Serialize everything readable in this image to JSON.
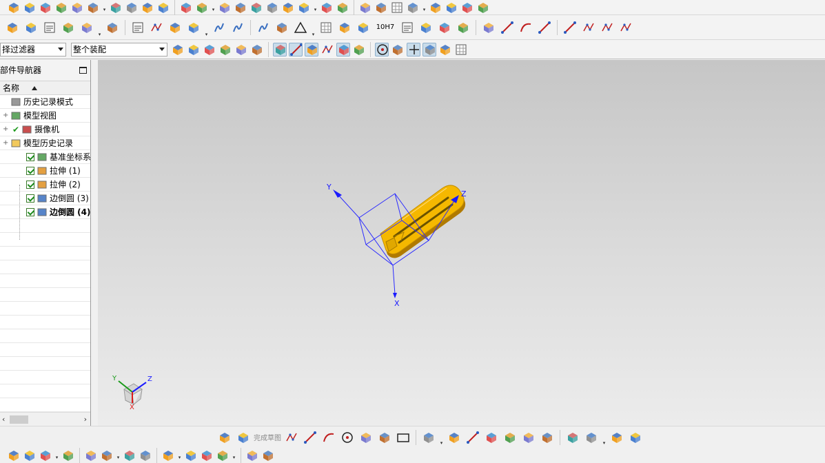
{
  "filters": {
    "selection_filter": "择过滤器",
    "scope": "整个装配"
  },
  "toolbar": {
    "row1_icons": [
      "block-icon",
      "cylinder-icon",
      "cube-icon",
      "extrude-icon",
      "chamfer-icon",
      "shell-icon",
      "boss-icon",
      "pattern-icon",
      "array-icon",
      "sweep-icon",
      "wedge-icon",
      "cube-blend-icon",
      "sheet-icon",
      "revolve-icon",
      "box-icon",
      "tube-icon",
      "cone-icon",
      "mirror-icon",
      "trim-icon",
      "surface-icon",
      "mesh-icon",
      "pyramid-icon",
      "grid-surface-icon",
      "patch-icon",
      "bridge-icon",
      "offset-icon",
      "section-icon",
      "sew-icon",
      "shape-icon",
      "warning-icon"
    ],
    "row2_icons": [
      "layers-icon",
      "stack-icon",
      "sketch-pad-icon",
      "hammer-icon",
      "tools-icon",
      "box-pair-icon",
      "text-abc-icon",
      "curve-edit-icon",
      "surface-warp-icon",
      "measure-icon",
      "coil-icon",
      "spring-icon",
      "thread-icon",
      "wrench-icon",
      "triangle-icon",
      "table-icon",
      "symbol-icon",
      "gears-icon",
      "note-icon",
      "dimension-arrow-icon",
      "tolerance-icon",
      "part-icon",
      "assembly-icon",
      "line-icon",
      "arc-icon",
      "polyline-icon",
      "spline-icon",
      "fillet-curve-icon",
      "offset-curve-icon",
      "project-curve-icon"
    ],
    "tolerance_label": "10H7",
    "snap_icons": [
      "wcs-icon",
      "select-icon",
      "lasso-icon",
      "box-select-icon",
      "face-icon",
      "body-icon",
      "point-icon",
      "line-snap-icon",
      "midpoint-icon",
      "curve-snap-icon",
      "intersection-icon",
      "tangent-icon",
      "center-icon",
      "quadrant-icon",
      "plus-icon",
      "slash-icon",
      "normal-icon",
      "grid-icon"
    ]
  },
  "navigator": {
    "title": "部件导航器",
    "column_name": "名称",
    "items": [
      {
        "label": "历史记录模式",
        "icon": "clock-icon"
      },
      {
        "label": "模型视图",
        "icon": "model-view-icon"
      },
      {
        "label": "摄像机",
        "icon": "camera-icon"
      },
      {
        "label": "模型历史记录",
        "icon": "folder-icon"
      },
      {
        "label": "基准坐标系",
        "icon": "datum-csys-icon"
      },
      {
        "label": "拉伸 (1)",
        "icon": "extrude-feature-icon"
      },
      {
        "label": "拉伸 (2)",
        "icon": "extrude-feature-icon"
      },
      {
        "label": "边倒圆 (3)",
        "icon": "edge-blend-icon"
      },
      {
        "label": "边倒圆 (4)",
        "icon": "edge-blend-icon"
      }
    ]
  },
  "viewport": {
    "axis_labels": {
      "x": "X",
      "y": "Y",
      "z": "Z"
    },
    "triad_labels": {
      "x": "X",
      "y": "Y",
      "z": "Z"
    },
    "part_color": "#f5b800",
    "csys_color": "#1a1aff"
  },
  "sketch_toolbar": {
    "finish_sketch": "完成草图",
    "icons": [
      "sketch-icon",
      "finish-sketch-icon",
      "profile-icon",
      "line-tool-icon",
      "arc-tool-icon",
      "circle-icon",
      "fillet-icon",
      "chamfer-tool-icon",
      "rectangle-icon",
      "polygon-icon",
      "point-tool-icon",
      "studio-spline-icon",
      "trim-tool-icon",
      "extend-icon",
      "corner-icon",
      "offset-tool-icon",
      "mirror-tool-icon",
      "constraint-icon",
      "dimension-tool-icon",
      "display-constraints-icon"
    ]
  },
  "bottom_toolbar": {
    "icons": [
      "view-icon",
      "image-icon",
      "add-component-icon",
      "move-icon",
      "mirror-assy-icon",
      "constraint-assy-icon",
      "explode-icon",
      "sequence-icon",
      "wave-icon",
      "clone-icon",
      "measure-tool-icon",
      "analysis-icon",
      "deviation-icon",
      "route-icon"
    ]
  }
}
